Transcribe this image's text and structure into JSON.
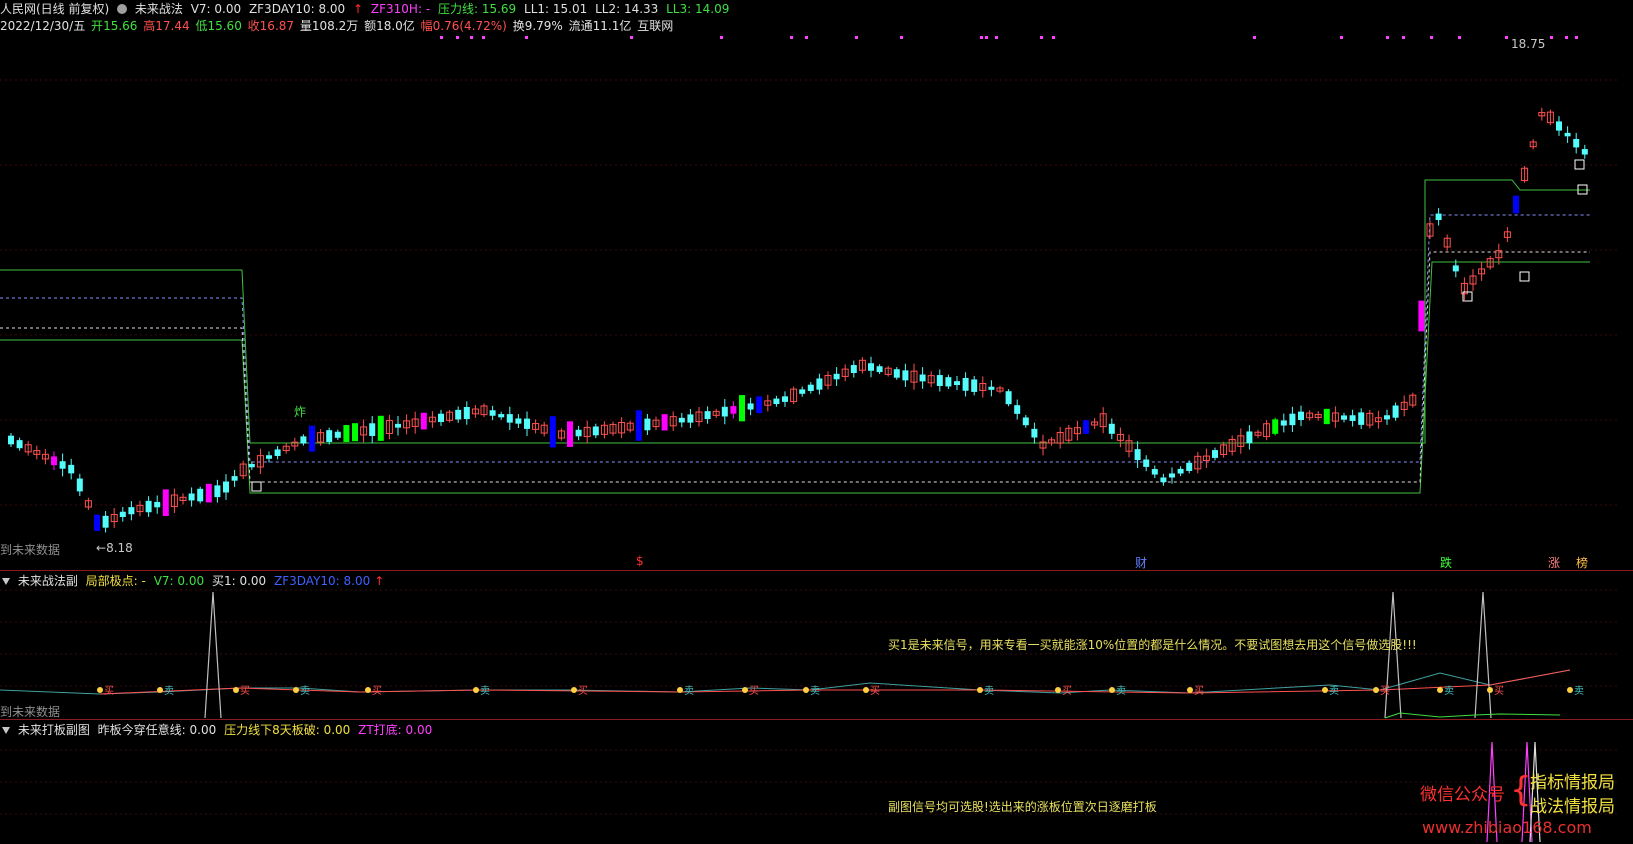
{
  "header": {
    "stock_name": "人民网(日线 前复权)",
    "indicator": "未来战法",
    "v7": "V7: 0.00",
    "zf3day": "ZF3DAY10: 8.00",
    "zf310h": "ZF310H: -",
    "pressure": "压力线: 15.69",
    "ll1": "LL1: 15.01",
    "ll2": "LL2: 14.33",
    "ll3": "LL3: 14.09"
  },
  "info_bar": {
    "date": "2022/12/30/五",
    "open_label": "开",
    "open": "15.66",
    "high_label": "高",
    "high": "17.44",
    "low_label": "低",
    "low": "15.60",
    "close_label": "收",
    "close": "16.87",
    "vol_label": "量",
    "vol": "108.2万",
    "amount_label": "额",
    "amount": "18.0亿",
    "change_label": "幅",
    "change": "0.76(4.72%)",
    "turnover_label": "换",
    "turnover": "9.79%",
    "float_label": "流通",
    "float_cap": "11.1亿",
    "sector": "互联网"
  },
  "price_labels": {
    "high": "18.75",
    "low": "8.18"
  },
  "main_markers": {
    "zha": "炸",
    "future_data": "到未来数据",
    "m1": "$",
    "m2": "财",
    "m3": "跌",
    "m4": "涨",
    "m5": "榜"
  },
  "sub1": {
    "name": "未来战法副",
    "local_extreme": "局部极点: -",
    "v7": "V7: 0.00",
    "buy1": "买1: 0.00",
    "zf3day": "ZF3DAY10: 8.00",
    "note": "买1是未来信号，用来专看一买就能涨10%位置的都是什么情况。不要试图想去用这个信号做选股!!!",
    "future_data": "到未来数据",
    "buy_marker": "买",
    "sell_marker": "卖"
  },
  "sub2": {
    "name": "未来打板副图",
    "line1": "昨板今穿任意线: 0.00",
    "line2": "压力线下8天板破: 0.00",
    "line3": "ZT打底: 0.00",
    "note": "副图信号均可选股!选出来的涨板位置次日逐磨打板"
  },
  "watermark": {
    "wechat": "微信公众号",
    "brand1": "指标情报局",
    "brand2": "战法情报局",
    "url": "www.zhibiao168.com"
  },
  "colors": {
    "up": "#ff5050",
    "down": "#54fcfc",
    "magenta": "#ff00ff",
    "blue": "#0000ff",
    "green": "#00ff00",
    "line_green": "#40c040",
    "pink": "#ff40ff"
  }
}
